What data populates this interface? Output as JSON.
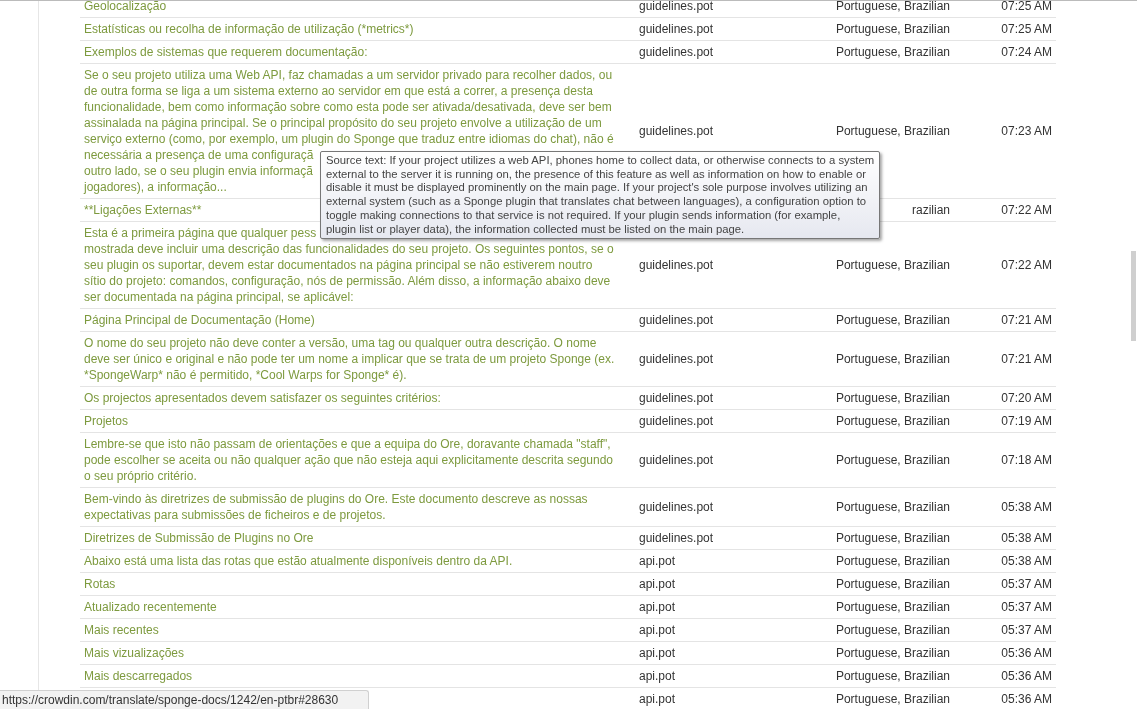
{
  "rows": [
    {
      "text": "Geolocalização",
      "file": "guidelines.pot",
      "language": "Portuguese, Brazilian",
      "time": "07:25 AM"
    },
    {
      "text": "Estatísticas ou recolha de informação de utilização (*metrics*)",
      "file": "guidelines.pot",
      "language": "Portuguese, Brazilian",
      "time": "07:25 AM"
    },
    {
      "text": "Exemplos de sistemas que requerem documentação:",
      "file": "guidelines.pot",
      "language": "Portuguese, Brazilian",
      "time": "07:24 AM"
    },
    {
      "text": "Se o seu projeto utiliza uma Web API, faz chamadas a um servidor privado para recolher dados, ou\nde outra forma se liga a um sistema externo ao servidor em que está a correr, a presença desta\nfuncionalidade, bem como informação sobre como esta pode ser ativada/desativada, deve ser bem\nassinalada na página principal. Se o principal propósito do seu projeto envolve a utilização de um\nserviço externo (como, por exemplo, um plugin do Sponge que traduz entre idiomas do chat), não é\nnecessária a presença de uma configuraçã\noutro lado, se o seu plugin envia informaçã\njogadores), a informação...",
      "file": "guidelines.pot",
      "language": "Portuguese, Brazilian",
      "time": "07:23 AM"
    },
    {
      "text": "**Ligações Externas**",
      "language": "razilian",
      "time": "07:22 AM"
    },
    {
      "text": "Esta é a primeira página que qualquer pess\nmostrada deve incluir uma descrição das funcionalidades do seu projeto. Os seguintes pontos, se o\nseu plugin os suportar, devem estar documentados na página principal se não estiverem noutro\nsítio do projeto: comandos, configuração, nós de permissão. Além disso, a informação abaixo deve\nser documentada na página principal, se aplicável:",
      "file": "guidelines.pot",
      "language": "Portuguese, Brazilian",
      "time": "07:22 AM"
    },
    {
      "text": "Página Principal de Documentação (Home)",
      "file": "guidelines.pot",
      "language": "Portuguese, Brazilian",
      "time": "07:21 AM"
    },
    {
      "text": "O nome do seu projeto não deve conter a versão, uma tag ou qualquer outra descrição. O nome\ndeve ser único e original e não pode ter um nome a implicar que se trata de um projeto Sponge (ex.\n*SpongeWarp* não é permitido, *Cool Warps for Sponge* é).",
      "file": "guidelines.pot",
      "language": "Portuguese, Brazilian",
      "time": "07:21 AM"
    },
    {
      "text": "Os projectos apresentados devem satisfazer os seguintes critérios:",
      "file": "guidelines.pot",
      "language": "Portuguese, Brazilian",
      "time": "07:20 AM"
    },
    {
      "text": "Projetos",
      "file": "guidelines.pot",
      "language": "Portuguese, Brazilian",
      "time": "07:19 AM"
    },
    {
      "text": "Lembre-se que isto não passam de orientações e que a equipa do Ore, doravante chamada \"staff\",\npode escolher se aceita ou não qualquer ação que não esteja aqui explicitamente descrita segundo\no seu próprio critério.",
      "file": "guidelines.pot",
      "language": "Portuguese, Brazilian",
      "time": "07:18 AM"
    },
    {
      "text": "Bem-vindo às diretrizes de submissão de plugins do Ore. Este documento descreve as nossas\nexpectativas para submissões de ficheiros e de projetos.",
      "file": "guidelines.pot",
      "language": "Portuguese, Brazilian",
      "time": "05:38 AM"
    },
    {
      "text": "Diretrizes de Submissão de Plugins no Ore",
      "file": "guidelines.pot",
      "language": "Portuguese, Brazilian",
      "time": "05:38 AM"
    },
    {
      "text": "Abaixo está uma lista das rotas que estão atualmente disponíveis dentro da API.",
      "file": "api.pot",
      "language": "Portuguese, Brazilian",
      "time": "05:38 AM"
    },
    {
      "text": "Rotas",
      "file": "api.pot",
      "language": "Portuguese, Brazilian",
      "time": "05:37 AM"
    },
    {
      "text": "Atualizado recentemente",
      "file": "api.pot",
      "language": "Portuguese, Brazilian",
      "time": "05:37 AM"
    },
    {
      "text": "Mais recentes",
      "file": "api.pot",
      "language": "Portuguese, Brazilian",
      "time": "05:37 AM"
    },
    {
      "text": "Mais vizualizações",
      "file": "api.pot",
      "language": "Portuguese, Brazilian",
      "time": "05:36 AM"
    },
    {
      "text": "Mais descarregados",
      "file": "api.pot",
      "language": "Portuguese, Brazilian",
      "time": "05:36 AM"
    },
    {
      "file": "api.pot",
      "language": "Portuguese, Brazilian",
      "time": "05:36 AM"
    }
  ],
  "tooltip": "Source text: If your project utilizes a web API, phones home to collect data, or otherwise connects to a system\nexternal to the server it is running on, the presence of this feature as well as information on how to enable or\ndisable it must be displayed prominently on the main page. If your project's sole purpose involves utilizing an\nexternal system (such as a Sponge plugin that translates chat between languages), a configuration option to\ntoggle making connections to that service is not required. If your plugin sends information (for example,\nplugin list or player data), the information collected must be listed on the main page.",
  "status_url": "https://crowdin.com/translate/sponge-docs/1242/en-ptbr#28630"
}
